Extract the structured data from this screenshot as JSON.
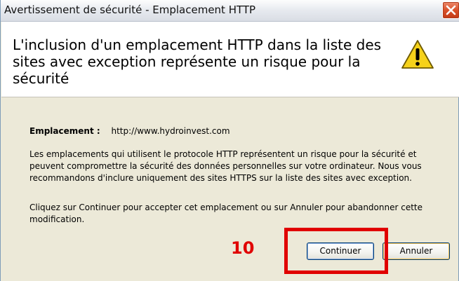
{
  "window": {
    "title": "Avertissement de sécurité - Emplacement HTTP"
  },
  "header": {
    "message": "L'inclusion d'un emplacement HTTP dans la liste des sites avec exception représente un risque pour la sécurité",
    "icon": "warning-icon"
  },
  "details": {
    "location_label": "Emplacement :",
    "location_value": "http://www.hydroinvest.com",
    "paragraph_risk": "Les emplacements qui utilisent le protocole HTTP représentent un risque pour la sécurité et peuvent compromettre la sécurité des données personnelles sur votre ordinateur. Nous vous recommandons d'inclure uniquement des sites HTTPS sur la liste des sites avec exception.",
    "paragraph_action": "Cliquez sur Continuer pour accepter cet emplacement ou sur Annuler pour abandonner cette modification."
  },
  "buttons": {
    "continue_label": "Continuer",
    "cancel_label": "Annuler"
  },
  "annotation": {
    "step_number": "10",
    "color": "#e00000"
  },
  "colors": {
    "close_button": "#d9512a",
    "warning_yellow": "#f6d21a"
  }
}
